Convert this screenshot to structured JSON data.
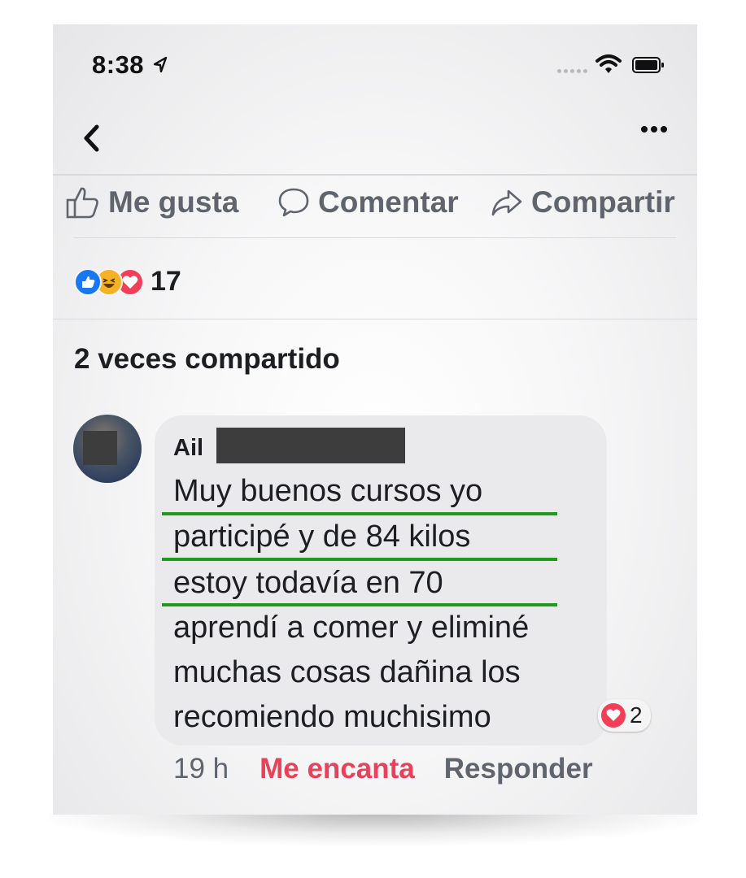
{
  "status_bar": {
    "time": "8:38"
  },
  "nav": {
    "back_icon": "chevron-left-icon",
    "more_icon": "more-horizontal-icon"
  },
  "actions": {
    "like": "Me gusta",
    "comment": "Comentar",
    "share": "Compartir"
  },
  "reactions": {
    "icons": [
      "like-reaction",
      "haha-reaction",
      "love-reaction"
    ],
    "count": "17"
  },
  "shares_label": "2 veces compartido",
  "comment": {
    "author_visible": "Ail",
    "lines": [
      "Muy buenos cursos yo",
      "participé y de 84 kilos",
      "estoy todavía en 70",
      "aprendí a comer y eliminé",
      "muchas cosas dañina los",
      "recomiendo muchisimo"
    ],
    "reaction_count": "2",
    "time": "19 h",
    "love_label": "Me encanta",
    "reply_label": "Responder"
  },
  "colors": {
    "accent_love": "#e8425a",
    "underline": "#1f9a1a",
    "like_blue": "#1877f2"
  }
}
